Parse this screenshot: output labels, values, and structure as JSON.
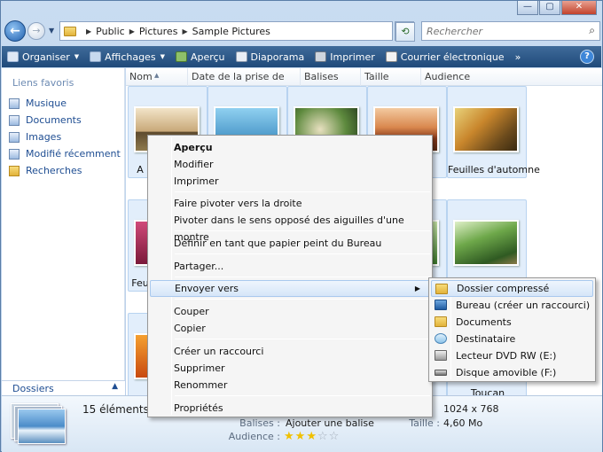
{
  "window": {
    "controls": [
      "—",
      "▢",
      "✕"
    ]
  },
  "address": {
    "breadcrumb": [
      "Public",
      "Pictures",
      "Sample Pictures"
    ],
    "search_placeholder": "Rechercher"
  },
  "toolbar": {
    "items": [
      {
        "label": "Organiser",
        "icon": "organize-icon",
        "has_caret": true
      },
      {
        "label": "Affichages",
        "icon": "views-icon",
        "has_caret": true
      },
      {
        "label": "Aperçu",
        "icon": "preview-icon",
        "has_caret": false
      },
      {
        "label": "Diaporama",
        "icon": "slideshow-icon",
        "has_caret": false
      },
      {
        "label": "Imprimer",
        "icon": "printer-icon",
        "has_caret": false
      },
      {
        "label": "Courrier électronique",
        "icon": "email-icon",
        "has_caret": false
      }
    ],
    "more": "»",
    "help": "?"
  },
  "sidebar": {
    "title": "Liens favoris",
    "items": [
      "Musique",
      "Documents",
      "Images",
      "Modifié récemment",
      "Recherches"
    ],
    "folders_label": "Dossiers"
  },
  "columns": [
    "Nom",
    "Date de la prise de vue",
    "Balises",
    "Taille",
    "Audience"
  ],
  "tiles": {
    "row1_first_label": "A",
    "row1_last_label": "Feuilles d'automne",
    "row2_first_label": "Feu",
    "row3_last_label": "Toucan"
  },
  "context_menu": {
    "items": [
      {
        "label": "Aperçu",
        "bold": true
      },
      {
        "label": "Modifier"
      },
      {
        "label": "Imprimer"
      },
      {
        "label": "Faire pivoter vers la droite"
      },
      {
        "label": "Pivoter dans le sens opposé des aiguilles d'une montre"
      },
      {
        "label": "Définir en tant que papier peint du Bureau"
      },
      {
        "label": "Partager..."
      },
      {
        "label": "Envoyer vers",
        "submenu": true,
        "highlighted": true
      },
      {
        "label": "Couper"
      },
      {
        "label": "Copier"
      },
      {
        "label": "Créer un raccourci"
      },
      {
        "label": "Supprimer"
      },
      {
        "label": "Renommer"
      },
      {
        "label": "Propriétés"
      }
    ]
  },
  "send_to_menu": {
    "items": [
      {
        "label": "Dossier compressé",
        "icon": "zip-folder-icon",
        "highlighted": true
      },
      {
        "label": "Bureau (créer un raccourci)",
        "icon": "desktop-icon"
      },
      {
        "label": "Documents",
        "icon": "documents-folder-icon"
      },
      {
        "label": "Destinataire",
        "icon": "mail-recipient-icon"
      },
      {
        "label": "Lecteur DVD RW (E:)",
        "icon": "dvd-drive-icon"
      },
      {
        "label": "Disque amovible (F:)",
        "icon": "removable-disk-icon"
      }
    ]
  },
  "details": {
    "count": "15 éléments sé",
    "tags_label": "Balises :",
    "tags_value": "Ajouter une balise",
    "rating_label": "Audience :",
    "rating_stars": 3,
    "rating_max": 5,
    "dimensions": "1024 x 768",
    "size_label": "Taille :",
    "size_value": "4,60 Mo"
  }
}
